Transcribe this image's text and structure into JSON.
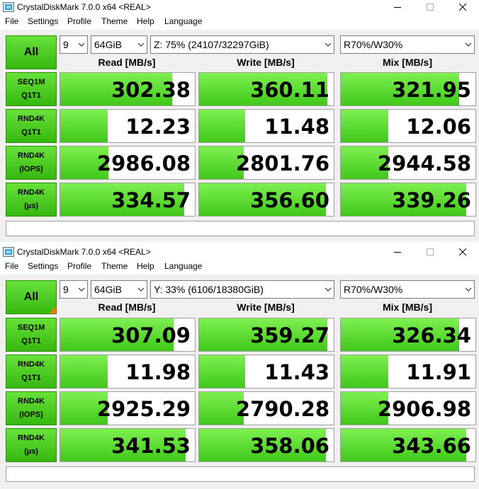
{
  "windows": [
    {
      "title": "CrystalDiskMark 7.0.0 x64 <REAL>",
      "menu": [
        "File",
        "Settings",
        "Profile",
        "Theme",
        "Help",
        "Language"
      ],
      "all_label": "All",
      "count": "9",
      "size": "64GiB",
      "drive": "Z: 75% (24107/32297GiB)",
      "mix": "R70%/W30%",
      "headers": [
        "Read [MB/s]",
        "Write [MB/s]",
        "Mix [MB/s]"
      ],
      "rows": [
        {
          "line1": "SEQ1M",
          "line2": "Q1T1",
          "cells": [
            {
              "value": "302.38",
              "fill": 0.83
            },
            {
              "value": "360.11",
              "fill": 0.95
            },
            {
              "value": "321.95",
              "fill": 0.88
            }
          ]
        },
        {
          "line1": "RND4K",
          "line2": "Q1T1",
          "cells": [
            {
              "value": "12.23",
              "fill": 0.35
            },
            {
              "value": "11.48",
              "fill": 0.34
            },
            {
              "value": "12.06",
              "fill": 0.35
            }
          ]
        },
        {
          "line1": "RND4K",
          "line2": "(IOPS)",
          "cells": [
            {
              "value": "2986.08",
              "fill": 0.36
            },
            {
              "value": "2801.76",
              "fill": 0.33
            },
            {
              "value": "2944.58",
              "fill": 0.35
            }
          ]
        },
        {
          "line1": "RND4K",
          "line2": "(µs)",
          "cells": [
            {
              "value": "334.57",
              "fill": 0.92
            },
            {
              "value": "356.60",
              "fill": 0.94
            },
            {
              "value": "339.26",
              "fill": 0.93
            }
          ]
        }
      ],
      "comment": ""
    },
    {
      "title": "CrystalDiskMark 7.0.0 x64 <REAL>",
      "menu": [
        "File",
        "Settings",
        "Profile",
        "Theme",
        "Help",
        "Language"
      ],
      "all_label": "All",
      "count": "9",
      "size": "64GiB",
      "drive": "Y: 33% (6106/18380GiB)",
      "mix": "R70%/W30%",
      "headers": [
        "Read [MB/s]",
        "Write [MB/s]",
        "Mix [MB/s]"
      ],
      "rows": [
        {
          "line1": "SEQ1M",
          "line2": "Q1T1",
          "cells": [
            {
              "value": "307.09",
              "fill": 0.84
            },
            {
              "value": "359.27",
              "fill": 0.95
            },
            {
              "value": "326.34",
              "fill": 0.88
            }
          ]
        },
        {
          "line1": "RND4K",
          "line2": "Q1T1",
          "cells": [
            {
              "value": "11.98",
              "fill": 0.35
            },
            {
              "value": "11.43",
              "fill": 0.34
            },
            {
              "value": "11.91",
              "fill": 0.35
            }
          ]
        },
        {
          "line1": "RND4K",
          "line2": "(IOPS)",
          "cells": [
            {
              "value": "2925.29",
              "fill": 0.35
            },
            {
              "value": "2790.28",
              "fill": 0.33
            },
            {
              "value": "2906.98",
              "fill": 0.35
            }
          ]
        },
        {
          "line1": "RND4K",
          "line2": "(µs)",
          "cells": [
            {
              "value": "341.53",
              "fill": 0.93
            },
            {
              "value": "358.06",
              "fill": 0.94
            },
            {
              "value": "343.66",
              "fill": 0.93
            }
          ]
        }
      ],
      "comment": ""
    }
  ],
  "icons": {
    "app": "crystaldiskmark-app-icon",
    "minimize": "minimize-icon",
    "maximize": "maximize-icon",
    "close": "close-icon",
    "dropdown": "chevron-down-icon"
  },
  "colors": {
    "accent_green": "#40c81a",
    "label_green": "#36b80f",
    "corner_orange": "#ff7a00"
  }
}
